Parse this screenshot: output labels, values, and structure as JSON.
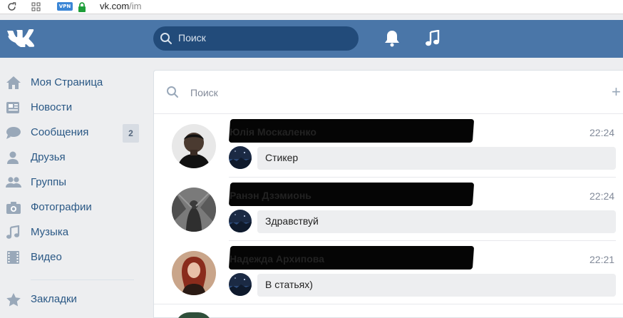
{
  "browser": {
    "vpn_label": "VPN",
    "url_host": "vk.com",
    "url_path": "/im"
  },
  "header": {
    "logo": "VK",
    "search_placeholder": "Поиск"
  },
  "sidebar": {
    "items": [
      {
        "label": "Моя Страница",
        "icon": "home-icon"
      },
      {
        "label": "Новости",
        "icon": "news-icon"
      },
      {
        "label": "Сообщения",
        "icon": "messages-icon",
        "badge": "2"
      },
      {
        "label": "Друзья",
        "icon": "friend-icon"
      },
      {
        "label": "Группы",
        "icon": "groups-icon"
      },
      {
        "label": "Фотографии",
        "icon": "camera-icon"
      },
      {
        "label": "Музыка",
        "icon": "music-icon"
      },
      {
        "label": "Видео",
        "icon": "video-icon"
      },
      {
        "label": "Закладки",
        "icon": "star-icon"
      }
    ]
  },
  "dialogs": {
    "search_placeholder": "Поиск",
    "new_label": "+",
    "items": [
      {
        "name": "Юлія Москаленко",
        "time": "22:24",
        "message": "Стикер"
      },
      {
        "name": "Ранэн Дзэмионь",
        "time": "22:24",
        "message": "Здравствуй"
      },
      {
        "name": "Надежда Архипова",
        "time": "22:21",
        "message": "В статьях)"
      }
    ]
  },
  "colors": {
    "header": "#4a76a8",
    "link": "#2a5885",
    "sidebar_icon": "#99a8b9"
  }
}
